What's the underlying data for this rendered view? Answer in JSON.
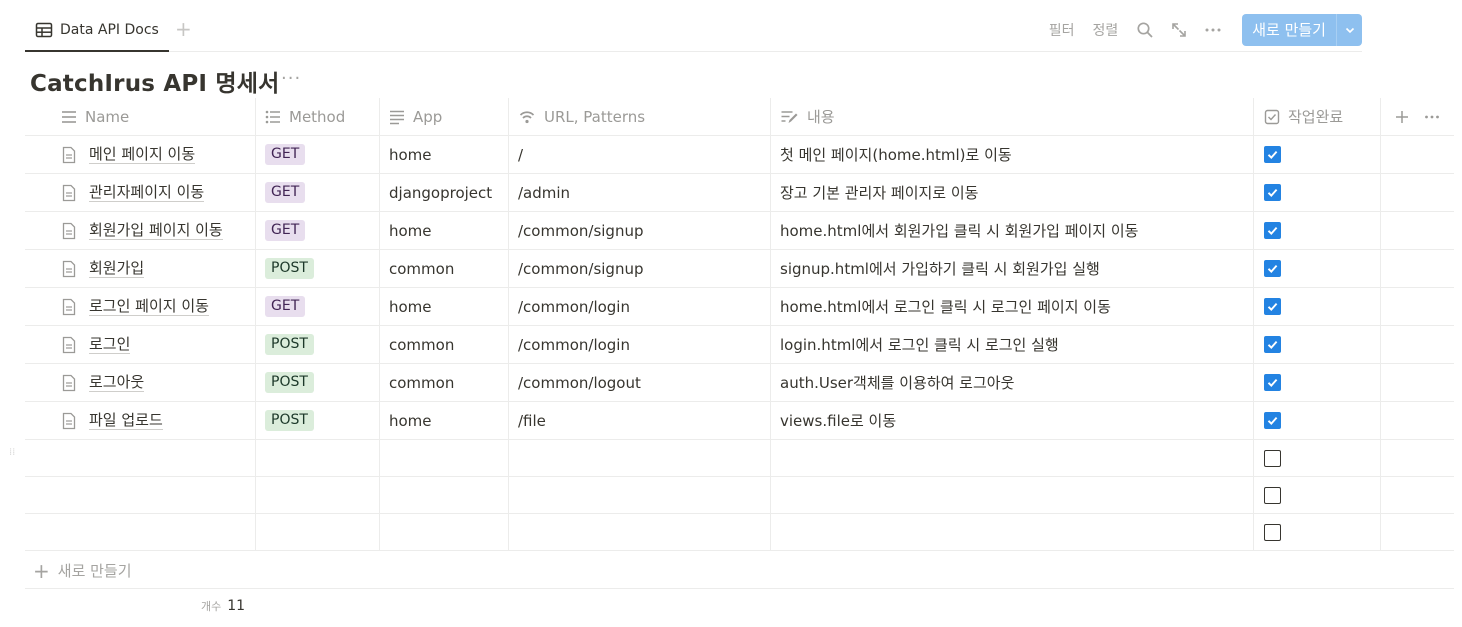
{
  "toolbar": {
    "view_tab_label": "Data API Docs",
    "filter_label": "필터",
    "sort_label": "정렬",
    "new_button_label": "새로 만들기",
    "icons": [
      "table-icon",
      "plus-icon",
      "search-icon",
      "expand-icon",
      "more-icon",
      "chevron-down-icon"
    ]
  },
  "page": {
    "title": "CatchIrus API 명세서"
  },
  "table": {
    "columns": [
      {
        "label": "Name",
        "icon": "text-lines-icon"
      },
      {
        "label": "Method",
        "icon": "list-icon"
      },
      {
        "label": "App",
        "icon": "paragraph-icon"
      },
      {
        "label": "URL, Patterns",
        "icon": "wifi-icon"
      },
      {
        "label": "내용",
        "icon": "edit-text-icon"
      },
      {
        "label": "작업완료",
        "icon": "checkbox-icon"
      }
    ],
    "rows": [
      {
        "name": "메인 페이지 이동",
        "method": "GET",
        "app": "home",
        "url": "/",
        "desc": "첫 메인 페이지(home.html)로 이동",
        "done": true
      },
      {
        "name": "관리자페이지 이동",
        "method": "GET",
        "app": "djangoproject",
        "url": "/admin",
        "desc": "장고 기본 관리자 페이지로 이동",
        "done": true
      },
      {
        "name": "회원가입 페이지 이동",
        "method": "GET",
        "app": "home",
        "url": "/common/signup",
        "desc": "home.html에서 회원가입 클릭 시 회원가입 페이지 이동",
        "done": true
      },
      {
        "name": "회원가입",
        "method": "POST",
        "app": "common",
        "url": "/common/signup",
        "desc": "signup.html에서 가입하기 클릭 시 회원가입 실행",
        "done": true
      },
      {
        "name": "로그인 페이지 이동",
        "method": "GET",
        "app": "home",
        "url": "/common/login",
        "desc": "home.html에서 로그인 클릭 시 로그인 페이지 이동",
        "done": true
      },
      {
        "name": "로그인",
        "method": "POST",
        "app": "common",
        "url": "/common/login",
        "desc": "login.html에서 로그인 클릭 시 로그인 실행",
        "done": true
      },
      {
        "name": "로그아웃",
        "method": "POST",
        "app": "common",
        "url": "/common/logout",
        "desc": "auth.User객체를 이용하여 로그아웃",
        "done": true
      },
      {
        "name": "파일 업로드",
        "method": "POST",
        "app": "home",
        "url": "/file",
        "desc": "views.file로 이동",
        "done": true
      },
      {
        "name": "",
        "method": "",
        "app": "",
        "url": "",
        "desc": "",
        "done": false
      },
      {
        "name": "",
        "method": "",
        "app": "",
        "url": "",
        "desc": "",
        "done": false
      },
      {
        "name": "",
        "method": "",
        "app": "",
        "url": "",
        "desc": "",
        "done": false
      }
    ],
    "new_row_label": "새로 만들기",
    "count_label": "개수",
    "count_value": "11"
  },
  "colors": {
    "accent": "#2383e2",
    "new_button": "#8ec0ef",
    "get_tag_bg": "#e8deee",
    "post_tag_bg": "#dbeddb"
  }
}
